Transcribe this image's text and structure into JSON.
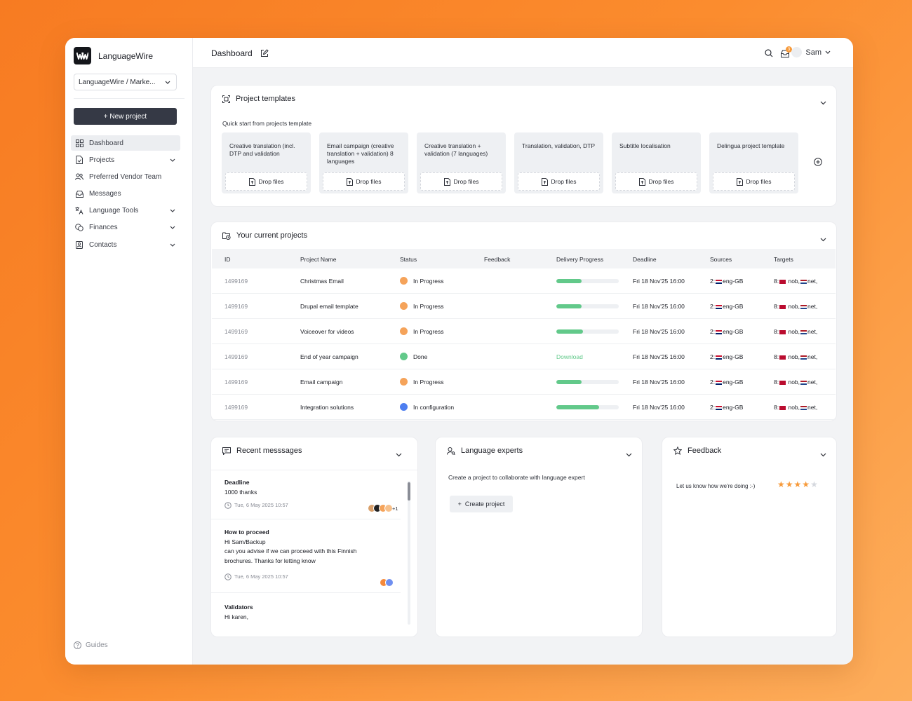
{
  "brand": {
    "name": "LanguageWire",
    "logo_text": "W"
  },
  "account": {
    "value": "LanguageWire / Marke..."
  },
  "sidebar": {
    "new_project": "+ New project",
    "items": [
      {
        "label": "Dashboard",
        "icon": "grid-icon",
        "active": true,
        "expandable": false
      },
      {
        "label": "Projects",
        "icon": "document-icon",
        "expandable": true
      },
      {
        "label": "Preferred Vendor Team",
        "icon": "people-icon",
        "expandable": false
      },
      {
        "label": "Messages",
        "icon": "inbox-icon",
        "expandable": false
      },
      {
        "label": "Language Tools",
        "icon": "translate-icon",
        "expandable": true
      },
      {
        "label": "Finances",
        "icon": "coins-icon",
        "expandable": true
      },
      {
        "label": "Contacts",
        "icon": "contact-icon",
        "expandable": true
      }
    ],
    "guides": "Guides"
  },
  "topbar": {
    "title": "Dashboard",
    "notification_count": "3",
    "user": "Sam"
  },
  "templates": {
    "title": "Project templates",
    "subtitle": "Quick start from projects template",
    "drop_label": "Drop files",
    "items": [
      {
        "name": "Creative translation (incl. DTP and validation"
      },
      {
        "name": "Email campaign (creative translation + validation) 8 languages"
      },
      {
        "name": "Creative translation + validation (7 languages)"
      },
      {
        "name": "Translation, validation, DTP"
      },
      {
        "name": "Subtitle localisation"
      },
      {
        "name": "Delingua project template"
      }
    ]
  },
  "projects": {
    "title": "Your current projects",
    "columns": [
      "ID",
      "Project Name",
      "Status",
      "Feedback",
      "Delivery Progress",
      "Deadline",
      "Sources",
      "Targets"
    ],
    "rows": [
      {
        "id": "1499169",
        "name": "Christmas Email",
        "status": "In Progress",
        "status_color": "#f5a35a",
        "progress": 0.4,
        "deadline": "Fri 18 Nov'25 16:00",
        "sources_count": "2:",
        "sources_lang": "eng-GB",
        "targets_count": "8:",
        "targets": "nob,",
        "targets2": "net,"
      },
      {
        "id": "1499169",
        "name": "Drupal email template",
        "status": "In Progress",
        "status_color": "#f5a35a",
        "progress": 0.41,
        "deadline": "Fri 18 Nov'25 16:00",
        "sources_count": "2:",
        "sources_lang": "eng-GB",
        "targets_count": "8:",
        "targets": "nob,",
        "targets2": "net,"
      },
      {
        "id": "1499169",
        "name": "Voiceover for videos",
        "status": "In Progress",
        "status_color": "#f5a35a",
        "progress": 0.43,
        "deadline": "Fri 18 Nov'25 16:00",
        "sources_count": "2:",
        "sources_lang": "eng-GB",
        "targets_count": "8:",
        "targets": "nob,",
        "targets2": "net,"
      },
      {
        "id": "1499169",
        "name": "End of year campaign",
        "status": "Done",
        "status_color": "#62c98a",
        "download": "Download",
        "deadline": "Fri 18 Nov'25 16:00",
        "sources_count": "2:",
        "sources_lang": "eng-GB",
        "targets_count": "8:",
        "targets": "nob,",
        "targets2": "net,"
      },
      {
        "id": "1499169",
        "name": "Email campaign",
        "status": "In Progress",
        "status_color": "#f5a35a",
        "progress": 0.4,
        "deadline": "Fri 18 Nov'25 16:00",
        "sources_count": "2:",
        "sources_lang": "eng-GB",
        "targets_count": "8:",
        "targets": "nob,",
        "targets2": "net,"
      },
      {
        "id": "1499169",
        "name": "Integration solutions",
        "status": "In configuration",
        "status_color": "#4d7ef0",
        "progress": 0.68,
        "deadline": "Fri 18 Nov'25 16:00",
        "sources_count": "2:",
        "sources_lang": "eng-GB",
        "targets_count": "8:",
        "targets": "nob,",
        "targets2": "net,"
      }
    ]
  },
  "messages": {
    "title": "Recent messsages",
    "items": [
      {
        "title": "Deadline",
        "body": [
          "1000 thanks"
        ],
        "time": "Tue, 6 May 2025 10:57",
        "avatar_colors": [
          "#d9a06b",
          "#222222",
          "#f5a35a",
          "#f7c08a"
        ],
        "more": "+1"
      },
      {
        "title": "How to proceed",
        "body": [
          "Hi Sam/Backup",
          "can you advise if we can proceed with this Finnish",
          "brochures. Thanks for letting know"
        ],
        "time": "Tue, 6 May 2025 10:57",
        "avatar_colors": [
          "#f5893a",
          "#6f8ff0"
        ]
      },
      {
        "title": "Validators",
        "body": [
          "Hi karen,"
        ]
      }
    ]
  },
  "experts": {
    "title": "Language experts",
    "description": "Create a project to collaborate with language expert",
    "button": "Create project"
  },
  "feedback": {
    "title": "Feedback",
    "prompt": "Let us know how we're doing :-)",
    "rating": 4,
    "max_rating": 5,
    "star_color": "#f79a3a"
  }
}
